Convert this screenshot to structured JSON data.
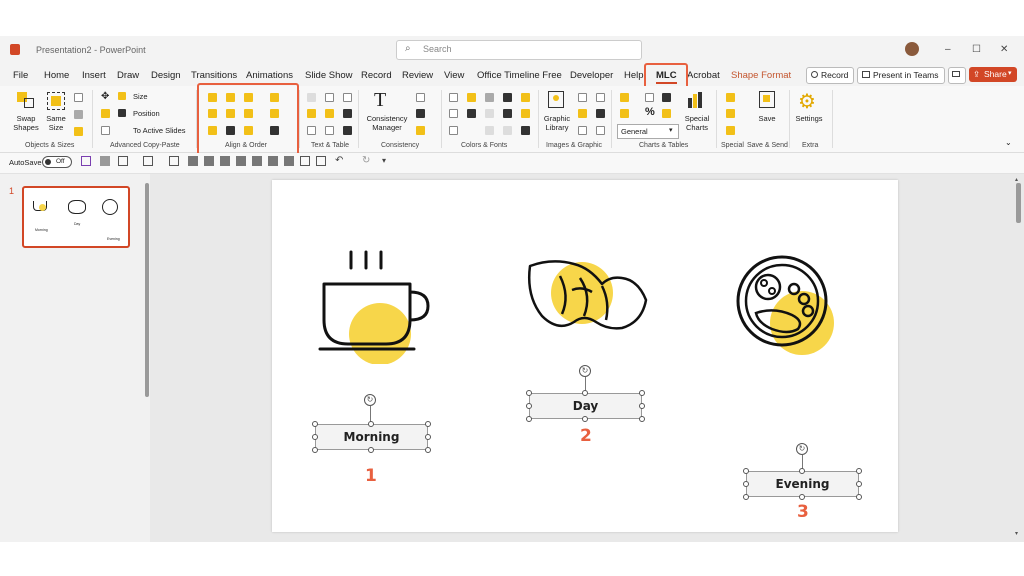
{
  "app": {
    "doc_title": "Presentation2",
    "app_name": "PowerPoint",
    "separator": "-"
  },
  "search": {
    "placeholder": "Search"
  },
  "window": {
    "minimize": "–",
    "maximize": "☐",
    "close": "✕"
  },
  "tabs": [
    "File",
    "Home",
    "Insert",
    "Draw",
    "Design",
    "Transitions",
    "Animations",
    "Slide Show",
    "Record",
    "Review",
    "View",
    "Office Timeline Free",
    "Developer",
    "Help",
    "MLC",
    "Acrobat",
    "Shape Format"
  ],
  "actions": {
    "record": "Record",
    "present": "Present in Teams",
    "share": "Share"
  },
  "ribbon": {
    "swap_shapes": "Swap Shapes",
    "same_size": "Same Size",
    "size": "Size",
    "position": "Position",
    "to_active_slides": "To Active Slides",
    "group_objects": "Objects & Sizes",
    "group_copy": "Advanced Copy-Paste",
    "group_align": "Align & Order",
    "group_text": "Text & Table",
    "consistency_manager": "Consistency Manager",
    "group_consistency": "Consistency",
    "group_colors": "Colors & Fonts",
    "graphic_library": "Graphic Library",
    "group_images": "Images & Graphic",
    "number_format": "General",
    "special_charts": "Special Charts",
    "group_charts": "Charts & Tables",
    "group_special": "Special",
    "save": "Save",
    "group_save": "Save & Send",
    "settings": "Settings",
    "group_extra": "Extra"
  },
  "qat": {
    "autosave": "AutoSave",
    "toggle": "Off"
  },
  "thumbnail": {
    "number": "1",
    "labels": [
      "Morning",
      "Day",
      "Evening"
    ]
  },
  "slide": {
    "labels": [
      "Morning",
      "Day",
      "Evening"
    ],
    "numbers": [
      "1",
      "2",
      "3"
    ]
  },
  "colors": {
    "accent": "#e8603f",
    "icon_yellow": "#f7d64a",
    "share": "#d24726"
  }
}
